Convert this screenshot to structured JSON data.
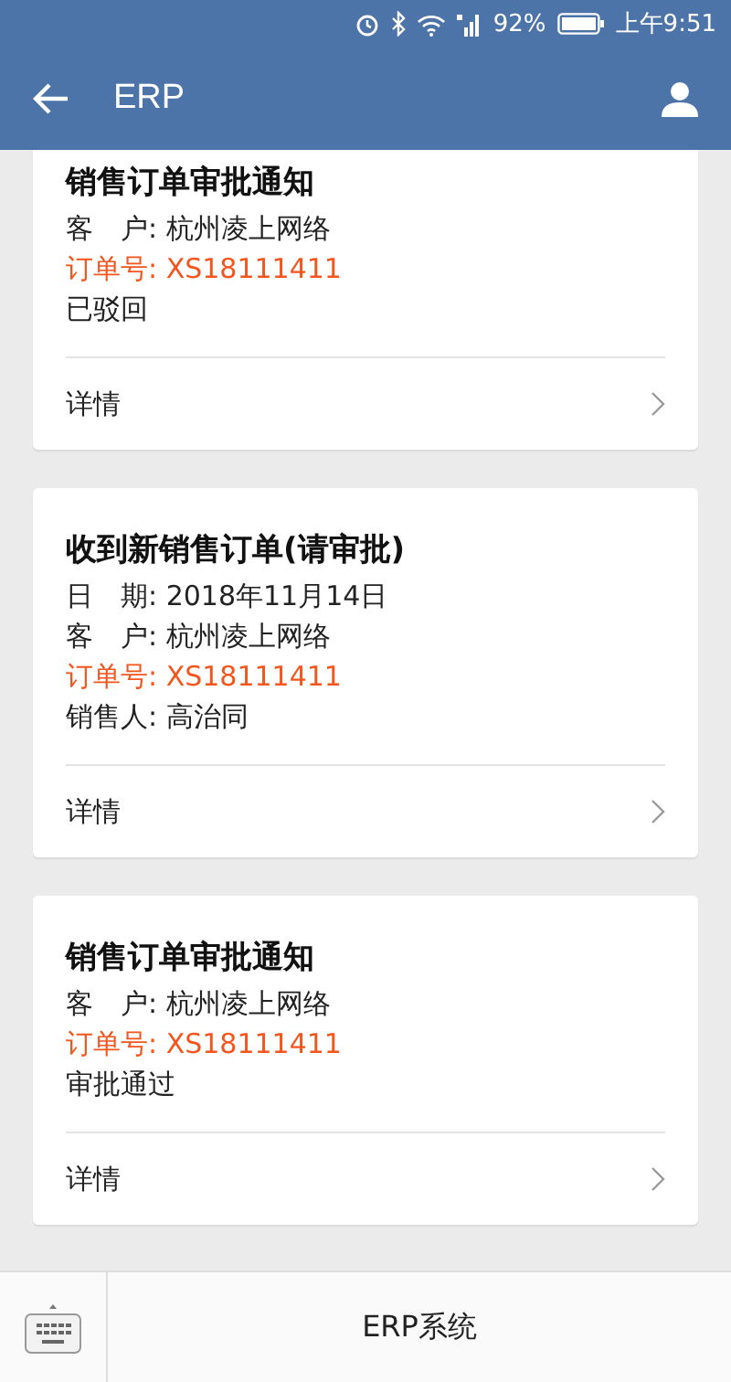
{
  "status_bar": {
    "battery_percent": "92%",
    "time": "上午9:51"
  },
  "header": {
    "title": "ERP"
  },
  "cards": [
    {
      "title": "销售订单审批通知",
      "lines": [
        {
          "kind": "plain",
          "text": "客　户: 杭州凌上网络"
        },
        {
          "kind": "order",
          "text": "订单号: XS18111411"
        },
        {
          "kind": "plain",
          "text": "已驳回"
        }
      ],
      "link": "详情"
    },
    {
      "title": "收到新销售订单(请审批)",
      "lines": [
        {
          "kind": "plain",
          "text": "日　期: 2018年11月14日"
        },
        {
          "kind": "plain",
          "text": "客　户: 杭州凌上网络"
        },
        {
          "kind": "order",
          "text": "订单号: XS18111411"
        },
        {
          "kind": "plain",
          "text": "销售人: 高治同"
        }
      ],
      "link": "详情"
    },
    {
      "title": "销售订单审批通知",
      "lines": [
        {
          "kind": "plain",
          "text": "客　户: 杭州凌上网络"
        },
        {
          "kind": "order",
          "text": "订单号: XS18111411"
        },
        {
          "kind": "plain",
          "text": "审批通过"
        }
      ],
      "link": "详情"
    }
  ],
  "bottom_bar": {
    "menu": "ERP系统"
  }
}
